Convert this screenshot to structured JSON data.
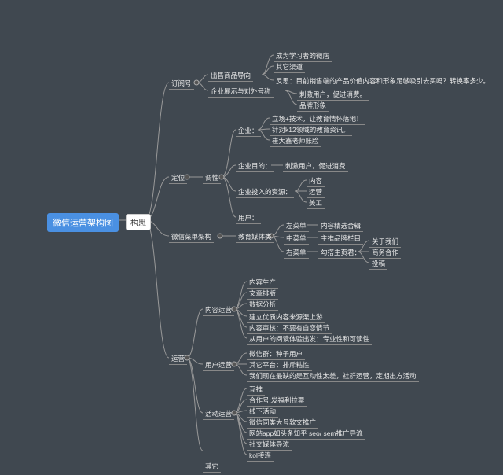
{
  "root": "微信运营架构图",
  "l1": "构思",
  "dyh": {
    "t": "订阅号",
    "c1": "出售商品导向",
    "c1a": "成为学习者的微店",
    "c1b": "其它渠道",
    "c1c": "反思：目前销售端的产品价值内容和形象足够吸引去买吗？转换率多少。",
    "c2": "企业展示与对外号称",
    "c2a": "刺激用户，促进消费。",
    "c2b": "品牌形象"
  },
  "dw": {
    "t": "定位",
    "tx": "调性",
    "qy": "企业：",
    "qy1": "立场+技术，让教育情怀落地！",
    "qy2": "针对k12领域的教育资讯。",
    "qy3": "崔大鑫老师账脸",
    "mb": "企业目的：",
    "mb1": "刺激用户，促进消费",
    "zy": "企业投入的资源：",
    "zy1": "内容",
    "zy2": "运营",
    "zy3": "美工",
    "yh": "用户："
  },
  "cd": {
    "t": "微信菜单架构",
    "jy": "教育媒体类",
    "z": "左菜单",
    "z1": "内容精选合辑",
    "m": "中菜单",
    "m1": "主推品牌栏目",
    "r": "右菜单",
    "rs": "勾搭主页君：",
    "r1": "关于我们",
    "r2": "商务合作",
    "r3": "投稿"
  },
  "yy": {
    "t": "运营",
    "nr": "内容运营",
    "nr1": "内容生产",
    "nr2": "文章排版",
    "nr3": "数据分析",
    "nr4": "建立优质内容来源渠上游",
    "nr5": "内容审核：不要有自恋情节",
    "nr6": "从用户的阅读体验出发：专业性和可读性",
    "yh": "用户运营",
    "yh1": "微信群：种子用户",
    "yh2": "其它平台：排斥粘性",
    "yh3": "我们现在最缺的是互动性太差，社群运营，定期出方活动",
    "hd": "活动运营",
    "hd1": "互推",
    "hd2": "合作号:发福利拉票",
    "hd3": "线下活动",
    "hd4": "微信同类大号软文推广",
    "hd5": "网站app如头条知乎 seo/ sem推广导流",
    "hd6": "社交媒体导流",
    "hd7": "kol接连",
    "qt": "其它"
  }
}
